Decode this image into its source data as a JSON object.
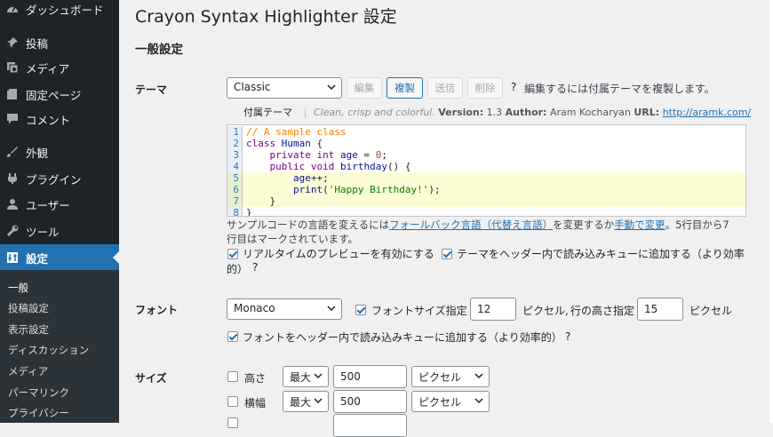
{
  "sidebar": {
    "items": [
      {
        "label": "ダッシュボード",
        "icon": "dashboard-icon"
      },
      {
        "label": "投稿",
        "icon": "pin-icon"
      },
      {
        "label": "メディア",
        "icon": "media-icon"
      },
      {
        "label": "固定ページ",
        "icon": "page-icon"
      },
      {
        "label": "コメント",
        "icon": "comment-icon"
      },
      {
        "label": "外観",
        "icon": "brush-icon"
      },
      {
        "label": "プラグイン",
        "icon": "plugin-icon"
      },
      {
        "label": "ユーザー",
        "icon": "user-icon"
      },
      {
        "label": "ツール",
        "icon": "wrench-icon"
      },
      {
        "label": "設定",
        "icon": "settings-icon"
      }
    ],
    "submenu": [
      "一般",
      "投稿設定",
      "表示設定",
      "ディスカッション",
      "メディア",
      "パーマリンク",
      "プライバシー"
    ]
  },
  "page": {
    "title": "Crayon Syntax Highlighter 設定",
    "section": "一般設定"
  },
  "theme": {
    "label": "テーマ",
    "selected": "Classic",
    "buttons": {
      "edit": "編集",
      "duplicate": "複製",
      "submit": "送信",
      "delete": "削除"
    },
    "help": "?",
    "hint": "編集するには付属テーマを複製します。",
    "info": {
      "tab": "付属テーマ",
      "description": "Clean, crisp and colorful.",
      "version_label": "Version:",
      "version": "1.3",
      "author_label": "Author:",
      "author": "Aram Kocharyan",
      "url_label": "URL:",
      "url": "http://aramk.com/"
    },
    "code_lines": [
      "1",
      "2",
      "3",
      "4",
      "5",
      "6",
      "7",
      "8"
    ],
    "description": {
      "pre": "サンプルコードの言語を変えるには",
      "link1": "フォールバック言語（代替え言語）",
      "mid": "を変更するか",
      "link2": "手動で変更",
      "post": "。5行目から7",
      "line2": "行目はマークされています。"
    },
    "option1": "リアルタイムのプレビューを有効にする",
    "option2": "テーマをヘッダー内で読み込みキューに追加する（より効率",
    "option2_cont": "的）",
    "option2_help": "?"
  },
  "font": {
    "label": "フォント",
    "selected": "Monaco",
    "size_label": "フォントサイズ指定",
    "size_value": "12",
    "px1": "ピクセル,",
    "line_height_label": "行の高さ指定",
    "line_height_value": "15",
    "px2": "ピクセル",
    "enqueue": "フォントをヘッダー内で読み込みキューに追加する（より効率的）",
    "enqueue_help": "?"
  },
  "size": {
    "label": "サイズ",
    "height_label": "高さ",
    "width_label": "横幅",
    "max": "最大",
    "height_value": "500",
    "width_value": "500",
    "unit": "ピクセル"
  }
}
